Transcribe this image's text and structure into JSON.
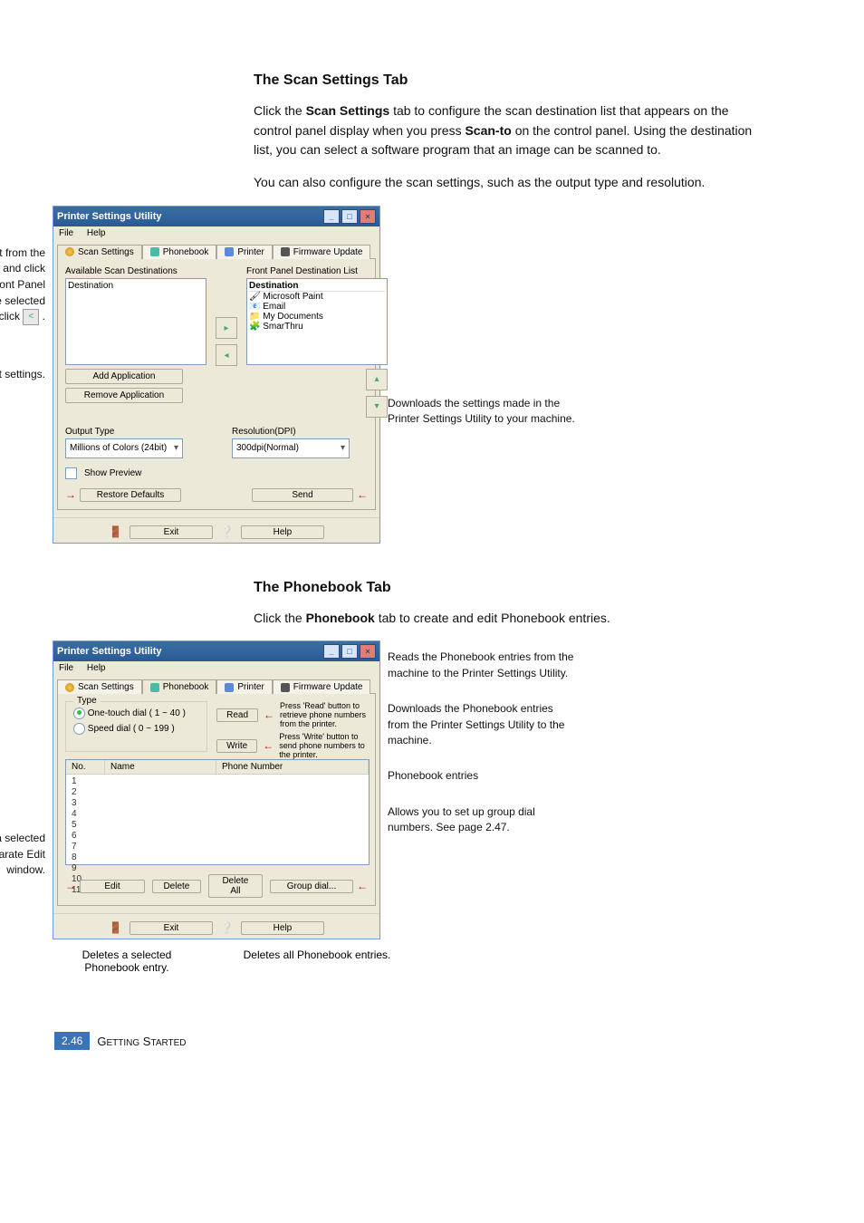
{
  "section1": {
    "title": "The Scan Settings Tab",
    "para1_a": "Click the ",
    "para1_b": "Scan Settings",
    "para1_c": " tab to configure the scan destination list that appears on the control panel display when you press ",
    "para1_d": "Scan-to",
    "para1_e": " on the control panel. Using the destination list, you can select a software program that an image can be scanned to.",
    "para2": "You can also configure the scan settings, such as the output type and resolution."
  },
  "scanCallouts": {
    "left1_a": "Select the program you want from the Available Scan Destinations and click ",
    "left1_b": " to add it to the Front Panel Destination List. To delete the selected program, click ",
    "left1_c": ".",
    "left_add_icon": ">",
    "left_del_icon": "<",
    "left2": "Click to restore the default settings.",
    "right1": "Downloads the settings made in the Printer Settings Utility to your machine."
  },
  "scanWin": {
    "title": "Printer Settings Utility",
    "menuFile": "File",
    "menuHelp": "Help",
    "tab1": "Scan Settings",
    "tab2": "Phonebook",
    "tab3": "Printer",
    "tab4": "Firmware Update",
    "availLabel": "Available Scan Destinations",
    "frontLabel": "Front Panel Destination List",
    "destHeader": "Destination",
    "destItems": [
      "Microsoft Paint",
      "Email",
      "My Documents",
      "SmarThru"
    ],
    "addApp": "Add Application",
    "removeApp": "Remove Application",
    "outputType": "Output Type",
    "outputVal": "Millions of Colors (24bit)",
    "resolution": "Resolution(DPI)",
    "resVal": "300dpi(Normal)",
    "showPreview": "Show Preview",
    "restore": "Restore Defaults",
    "send": "Send",
    "exit": "Exit",
    "help": "Help"
  },
  "section2": {
    "title": "The Phonebook Tab",
    "para_a": "Click the ",
    "para_b": "Phonebook",
    "para_c": " tab to create and edit Phonebook entries."
  },
  "pbCallouts": {
    "left1": "Allows you to edit a selected Phonebook entry in a separate Edit window.",
    "right1": "Reads the Phonebook entries from the machine to the Printer Settings Utility.",
    "right2": "Downloads the Phonebook entries from the Printer Settings Utility to the machine.",
    "right3": "Phonebook entries",
    "right4": "Allows you to set up group dial numbers. See page 2.47.",
    "bottom1": "Deletes a selected Phonebook entry.",
    "bottom2": "Deletes all Phonebook entries."
  },
  "pbWin": {
    "title": "Printer Settings Utility",
    "menuFile": "File",
    "menuHelp": "Help",
    "tab1": "Scan Settings",
    "tab2": "Phonebook",
    "tab3": "Printer",
    "tab4": "Firmware Update",
    "typeLabel": "Type",
    "radio1": "One-touch dial ( 1 ~ 40 )",
    "radio2": "Speed dial ( 0 ~ 199 )",
    "read": "Read",
    "readHint": "Press 'Read' button to retrieve phone numbers from the printer.",
    "write": "Write",
    "writeHint": "Press 'Write' button to send phone numbers to the printer.",
    "colNo": "No.",
    "colName": "Name",
    "colPhone": "Phone Number",
    "rows": [
      "1",
      "2",
      "3",
      "4",
      "5",
      "6",
      "7",
      "8",
      "9",
      "10",
      "11"
    ],
    "edit": "Edit",
    "delete": "Delete",
    "deleteAll": "Delete All",
    "groupDial": "Group dial...",
    "exit": "Exit",
    "help": "Help"
  },
  "footer": {
    "pageNum": "2.46",
    "chapter_a": "G",
    "chapter_b": "ETTING",
    "chapter_c": " S",
    "chapter_d": "TARTED"
  }
}
